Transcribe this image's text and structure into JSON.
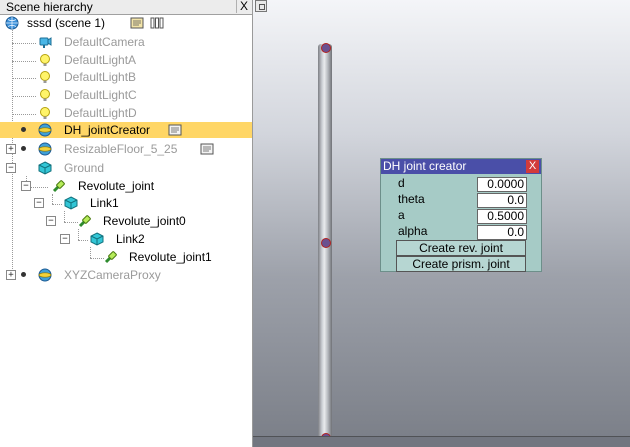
{
  "hierarchy": {
    "title": "Scene hierarchy",
    "close_label": "X",
    "root_label": "sssd (scene 1)",
    "items": [
      {
        "label": "DefaultCamera"
      },
      {
        "label": "DefaultLightA"
      },
      {
        "label": "DefaultLightB"
      },
      {
        "label": "DefaultLightC"
      },
      {
        "label": "DefaultLightD"
      },
      {
        "label": "DH_jointCreator"
      },
      {
        "label": "ResizableFloor_5_25"
      },
      {
        "label": "Ground"
      },
      {
        "label": "Revolute_joint"
      },
      {
        "label": "Link1"
      },
      {
        "label": "Revolute_joint0"
      },
      {
        "label": "Link2"
      },
      {
        "label": "Revolute_joint1"
      },
      {
        "label": "XYZCameraProxy"
      }
    ]
  },
  "dialog": {
    "title": "DH joint creator",
    "close_label": "X",
    "params": [
      {
        "name": "d",
        "value": "0.0000"
      },
      {
        "name": "theta",
        "value": "0.0"
      },
      {
        "name": "a",
        "value": "0.5000"
      },
      {
        "name": "alpha",
        "value": "0.0"
      }
    ],
    "buttons": {
      "rev": "Create rev. joint",
      "prism": "Create prism. joint"
    }
  },
  "colors": {
    "selection": "#ffd666",
    "dialog_bg": "#a6cbc6",
    "dialog_title": "#4a4fa8",
    "joint": "#6a5090"
  }
}
